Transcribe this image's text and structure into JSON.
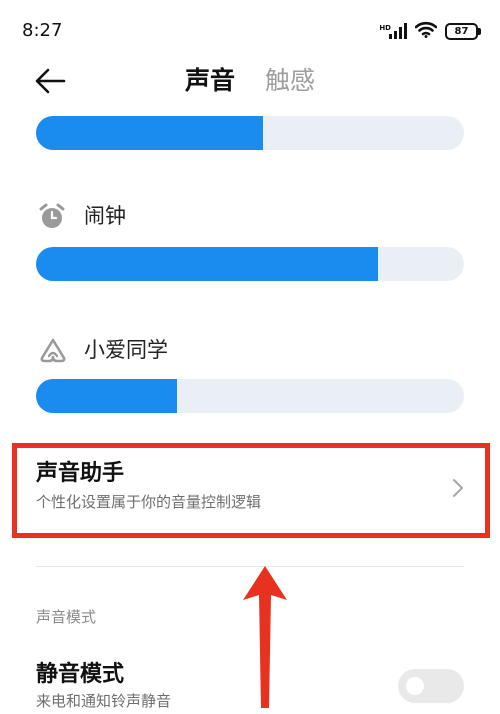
{
  "status_bar": {
    "time": "8:27",
    "network_label": "HD",
    "battery": "87"
  },
  "header": {
    "tabs": [
      {
        "label": "声音",
        "active": true
      },
      {
        "label": "触感",
        "active": false
      }
    ]
  },
  "volume_sliders": [
    {
      "label": "",
      "level": 0.53
    },
    {
      "label": "闹钟",
      "icon": "alarm-clock-icon",
      "level": 0.8
    },
    {
      "label": "小爱同学",
      "icon": "xiaoai-icon",
      "level": 0.33
    }
  ],
  "sound_assistant": {
    "title": "声音助手",
    "subtitle": "个性化设置属于你的音量控制逻辑"
  },
  "sound_mode_section": {
    "label": "声音模式",
    "silent_mode": {
      "title": "静音模式",
      "subtitle": "来电和通知铃声静音",
      "enabled": false
    }
  },
  "colors": {
    "accent": "#1a8cf0",
    "track": "#eaeef5",
    "highlight": "#e8321f"
  }
}
